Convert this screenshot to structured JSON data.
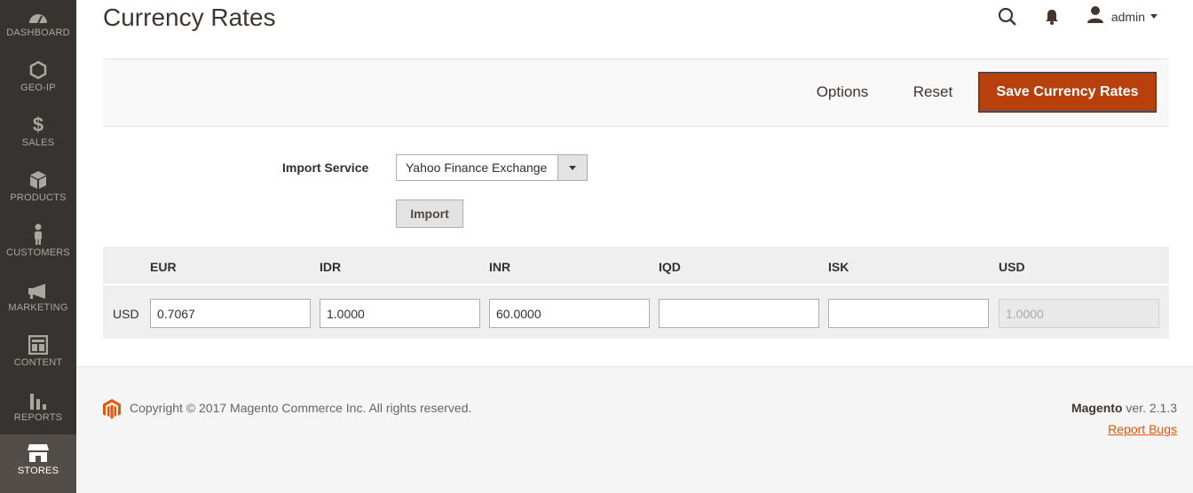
{
  "sidebar": {
    "items": [
      {
        "label": "DASHBOARD",
        "icon": "dashboard-icon"
      },
      {
        "label": "GEO-IP",
        "icon": "hexagon-icon"
      },
      {
        "label": "SALES",
        "icon": "dollar-icon"
      },
      {
        "label": "PRODUCTS",
        "icon": "box-icon"
      },
      {
        "label": "CUSTOMERS",
        "icon": "person-icon"
      },
      {
        "label": "MARKETING",
        "icon": "megaphone-icon"
      },
      {
        "label": "CONTENT",
        "icon": "layout-icon"
      },
      {
        "label": "REPORTS",
        "icon": "bar-chart-icon"
      },
      {
        "label": "STORES",
        "icon": "store-icon",
        "active": true
      }
    ]
  },
  "header": {
    "title": "Currency Rates",
    "user": "admin"
  },
  "actions": {
    "options": "Options",
    "reset": "Reset",
    "save": "Save Currency Rates"
  },
  "import": {
    "label": "Import Service",
    "service": "Yahoo Finance Exchange",
    "button": "Import"
  },
  "rates": {
    "columns": [
      "EUR",
      "IDR",
      "INR",
      "IQD",
      "ISK",
      "USD"
    ],
    "row_label": "USD",
    "values": [
      "0.7067",
      "1.0000",
      "60.0000",
      "",
      "",
      "1.0000"
    ]
  },
  "footer": {
    "copyright": "Copyright © 2017 Magento Commerce Inc. All rights reserved.",
    "brand": "Magento",
    "version": "ver. 2.1.3",
    "report_bugs": "Report Bugs"
  },
  "colors": {
    "sidebar_bg": "#373330",
    "accent": "#eb5202",
    "save_button": "#b8400d"
  }
}
